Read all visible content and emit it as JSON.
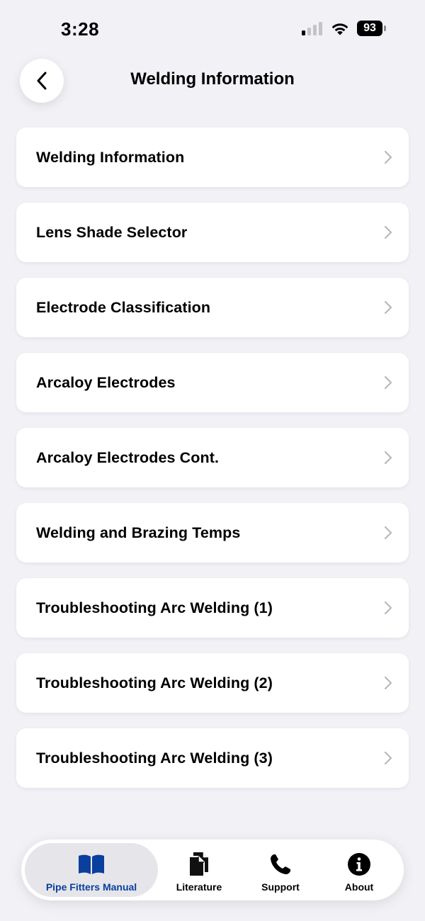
{
  "status_bar": {
    "time": "3:28",
    "battery_level": "93",
    "signal_bars_active": 1,
    "signal_bars_total": 4
  },
  "header": {
    "back_icon": "chevron-left-icon",
    "title": "Welding Information"
  },
  "menu": {
    "items": [
      {
        "label": "Welding Information"
      },
      {
        "label": "Lens Shade Selector"
      },
      {
        "label": "Electrode Classification"
      },
      {
        "label": "Arcaloy Electrodes"
      },
      {
        "label": "Arcaloy Electrodes Cont."
      },
      {
        "label": "Welding and Brazing Temps"
      },
      {
        "label": "Troubleshooting Arc Welding (1)"
      },
      {
        "label": "Troubleshooting Arc Welding (2)"
      },
      {
        "label": "Troubleshooting Arc Welding (3)"
      }
    ],
    "chevron_icon": "chevron-right-icon"
  },
  "tab_bar": {
    "tabs": [
      {
        "label": "Pipe Fitters Manual",
        "icon": "book-icon",
        "active": true
      },
      {
        "label": "Literature",
        "icon": "documents-icon",
        "active": false
      },
      {
        "label": "Support",
        "icon": "phone-icon",
        "active": false
      },
      {
        "label": "About",
        "icon": "info-icon",
        "active": false
      }
    ]
  },
  "colors": {
    "background": "#f1f1f6",
    "card": "#ffffff",
    "accent": "#0a3f9e",
    "chevron": "#b8b8bd",
    "active_tab_bg": "#e6e6ea"
  }
}
